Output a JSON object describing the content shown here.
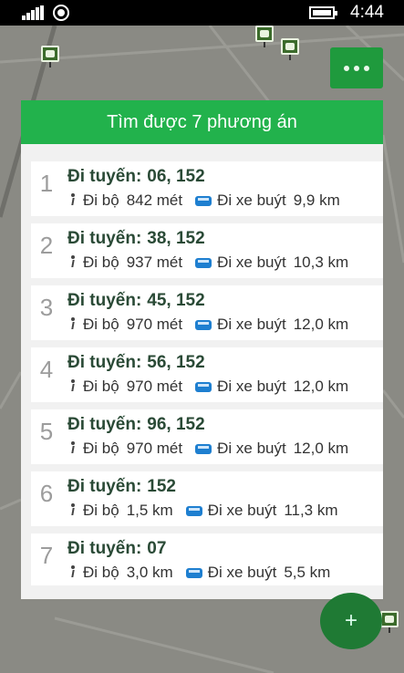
{
  "status_bar": {
    "time": "4:44"
  },
  "dialog": {
    "title": "Tìm được 7 phương án"
  },
  "labels": {
    "route_prefix": "Đi tuyến:",
    "walk": "Đi bộ",
    "bus": "Đi xe buýt"
  },
  "results": [
    {
      "index": "1",
      "routes": "06, 152",
      "walk_distance": "842 mét",
      "bus_distance": "9,9 km"
    },
    {
      "index": "2",
      "routes": "38, 152",
      "walk_distance": "937 mét",
      "bus_distance": "10,3 km"
    },
    {
      "index": "3",
      "routes": "45, 152",
      "walk_distance": "970 mét",
      "bus_distance": "12,0 km"
    },
    {
      "index": "4",
      "routes": "56, 152",
      "walk_distance": "970 mét",
      "bus_distance": "12,0 km"
    },
    {
      "index": "5",
      "routes": "96, 152",
      "walk_distance": "970 mét",
      "bus_distance": "12,0 km"
    },
    {
      "index": "6",
      "routes": "152",
      "walk_distance": "1,5 km",
      "bus_distance": "11,3 km"
    },
    {
      "index": "7",
      "routes": "07",
      "walk_distance": "3,0 km",
      "bus_distance": "5,5 km"
    }
  ],
  "fab": {
    "label": "+"
  },
  "colors": {
    "header": "#22b24c",
    "accent_dark": "#1f7a34",
    "bus_icon": "#1e7fd0"
  },
  "icons": [
    "signal-icon",
    "wifi-icon",
    "battery-icon",
    "more-icon",
    "walk-icon",
    "bus-icon",
    "bus-stop-icon",
    "add-icon"
  ]
}
